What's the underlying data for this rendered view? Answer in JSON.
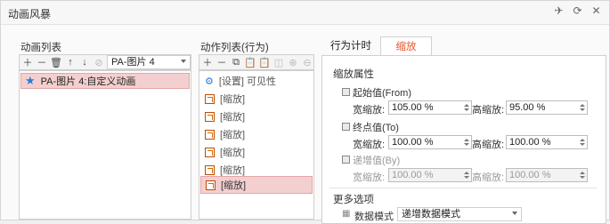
{
  "window": {
    "title": "动画风暴",
    "icons": [
      "pin-icon",
      "refresh-icon",
      "close-icon"
    ]
  },
  "left": {
    "label": "动画列表",
    "dropdown_value": "PA-图片 4",
    "items": [
      {
        "label": "PA-图片 4:自定义动画",
        "icon": "star-icon",
        "selected": true
      }
    ]
  },
  "middle": {
    "label": "动作列表(行为)",
    "items": [
      {
        "label": "[设置] 可见性",
        "icon": "gear-icon",
        "selected": false
      },
      {
        "label": "[缩放]",
        "icon": "scale-icon",
        "selected": false
      },
      {
        "label": "[缩放]",
        "icon": "scale-icon",
        "selected": false
      },
      {
        "label": "[缩放]",
        "icon": "scale-icon",
        "selected": false
      },
      {
        "label": "[缩放]",
        "icon": "scale-icon",
        "selected": false
      },
      {
        "label": "[缩放]",
        "icon": "scale-icon",
        "selected": false
      },
      {
        "label": "[缩放]",
        "icon": "scale-icon",
        "selected": true
      }
    ]
  },
  "right": {
    "tabs": [
      {
        "label": "行为计时",
        "active": false
      },
      {
        "label": "缩放",
        "active": true
      }
    ],
    "group_title": "缩放属性",
    "from": {
      "title": "起始值(From)",
      "width_label": "宽缩放:",
      "width_value": "105.00 %",
      "height_label": "高缩放:",
      "height_value": "95.00 %"
    },
    "to": {
      "title": "终点值(To)",
      "width_label": "宽缩放:",
      "width_value": "100.00 %",
      "height_label": "高缩放:",
      "height_value": "100.00 %"
    },
    "by": {
      "title": "递增值(By)",
      "width_label": "宽缩放:",
      "width_value": "100.00 %",
      "height_label": "高缩放:",
      "height_value": "100.00 %"
    },
    "more_title": "更多选项",
    "mode_label": "数据模式",
    "mode_value": "递增数据模式"
  },
  "colors": {
    "accent": "#e4572e",
    "selection_bg": "#f4cfcf"
  }
}
